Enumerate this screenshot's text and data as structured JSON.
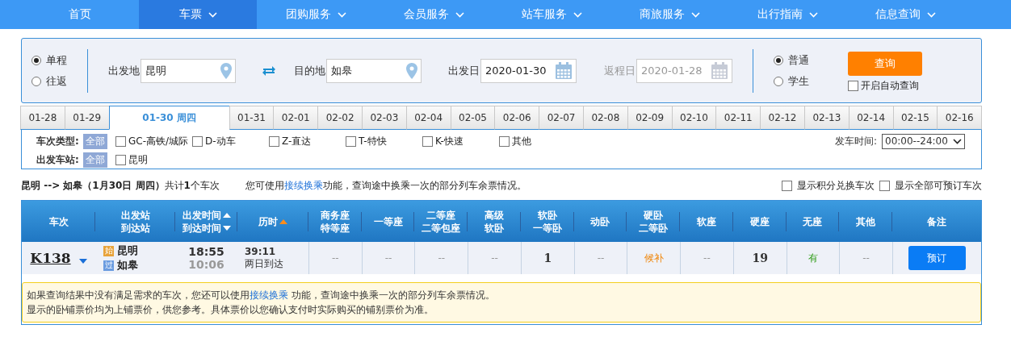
{
  "nav": [
    {
      "label": "首页",
      "dropdown": false,
      "selected": false
    },
    {
      "label": "车票",
      "dropdown": true,
      "selected": true
    },
    {
      "label": "团购服务",
      "dropdown": true,
      "selected": false
    },
    {
      "label": "会员服务",
      "dropdown": true,
      "selected": false
    },
    {
      "label": "站车服务",
      "dropdown": true,
      "selected": false
    },
    {
      "label": "商旅服务",
      "dropdown": true,
      "selected": false
    },
    {
      "label": "出行指南",
      "dropdown": true,
      "selected": false
    },
    {
      "label": "信息查询",
      "dropdown": true,
      "selected": false
    }
  ],
  "search": {
    "trip_types": [
      {
        "label": "单程",
        "selected": true
      },
      {
        "label": "往返",
        "selected": false
      }
    ],
    "from": {
      "label": "出发地",
      "value": "昆明"
    },
    "to": {
      "label": "目的地",
      "value": "如皋"
    },
    "depart_date": {
      "label": "出发日",
      "value": "2020-01-30",
      "disabled": false
    },
    "return_date": {
      "label": "返程日",
      "value": "2020-01-28",
      "disabled": true
    },
    "passenger_types": [
      {
        "label": "普通",
        "selected": true
      },
      {
        "label": "学生",
        "selected": false
      }
    ],
    "query_button": "查询",
    "auto_query": {
      "label": "开启自动查询",
      "checked": false
    }
  },
  "date_tabs": [
    {
      "label": "01-28",
      "selected": false
    },
    {
      "label": "01-29",
      "selected": false
    },
    {
      "label": "01-30 周四",
      "selected": true
    },
    {
      "label": "01-31",
      "selected": false
    },
    {
      "label": "02-01",
      "selected": false
    },
    {
      "label": "02-02",
      "selected": false
    },
    {
      "label": "02-03",
      "selected": false
    },
    {
      "label": "02-04",
      "selected": false
    },
    {
      "label": "02-05",
      "selected": false
    },
    {
      "label": "02-06",
      "selected": false
    },
    {
      "label": "02-07",
      "selected": false
    },
    {
      "label": "02-08",
      "selected": false
    },
    {
      "label": "02-09",
      "selected": false
    },
    {
      "label": "02-10",
      "selected": false
    },
    {
      "label": "02-11",
      "selected": false
    },
    {
      "label": "02-12",
      "selected": false
    },
    {
      "label": "02-13",
      "selected": false
    },
    {
      "label": "02-14",
      "selected": false
    },
    {
      "label": "02-15",
      "selected": false
    },
    {
      "label": "02-16",
      "selected": false
    }
  ],
  "filters": {
    "train_type": {
      "label": "车次类型:",
      "all": "全部",
      "options": [
        {
          "label": "GC-高铁/城际",
          "checked": false
        },
        {
          "label": "D-动车",
          "checked": false
        },
        {
          "label": "Z-直达",
          "checked": false
        },
        {
          "label": "T-特快",
          "checked": false
        },
        {
          "label": "K-快速",
          "checked": false
        },
        {
          "label": "其他",
          "checked": false
        }
      ]
    },
    "station": {
      "label": "出发车站:",
      "all": "全部",
      "options": [
        {
          "label": "昆明",
          "checked": false
        }
      ]
    },
    "depart_time": {
      "label": "发车时间:",
      "value": "00:00--24:00"
    }
  },
  "summary": {
    "text": "**昆明 --> 如皋（1月30日 周四）**共计**1**个车次",
    "note_prefix": "您可使用",
    "note_link": "接续换乘",
    "note_suffix": "功能，查询途中换乘一次的部分列车余票情况。"
  },
  "options": [
    {
      "label": "显示积分兑换车次",
      "checked": false
    },
    {
      "label": "显示全部可预订车次",
      "checked": false
    }
  ],
  "table": {
    "columns": [
      {
        "lines": [
          {
            "text": "车次"
          }
        ]
      },
      {
        "lines": [
          {
            "text": "出发站"
          },
          {
            "text": "到达站"
          }
        ]
      },
      {
        "lines": [
          {
            "text": "出发时间",
            "sort_up": true
          },
          {
            "text": "到达时间",
            "sort_down": true
          }
        ]
      },
      {
        "lines": [
          {
            "text": "历时",
            "sort_up": true
          }
        ],
        "sort_active": true
      },
      {
        "lines": [
          {
            "text": "商务座"
          },
          {
            "text": "特等座"
          }
        ]
      },
      {
        "lines": [
          {
            "text": "一等座"
          }
        ]
      },
      {
        "lines": [
          {
            "text": "二等座"
          },
          {
            "text": "二等包座"
          }
        ]
      },
      {
        "lines": [
          {
            "text": "高级"
          },
          {
            "text": "软卧"
          }
        ]
      },
      {
        "lines": [
          {
            "text": "软卧"
          },
          {
            "text": "一等卧"
          }
        ]
      },
      {
        "lines": [
          {
            "text": "动卧"
          }
        ]
      },
      {
        "lines": [
          {
            "text": "硬卧"
          },
          {
            "text": "二等卧"
          }
        ]
      },
      {
        "lines": [
          {
            "text": "软座"
          }
        ]
      },
      {
        "lines": [
          {
            "text": "硬座"
          }
        ]
      },
      {
        "lines": [
          {
            "text": "无座"
          }
        ]
      },
      {
        "lines": [
          {
            "text": "其他"
          }
        ]
      },
      {
        "lines": [
          {
            "text": "备注"
          }
        ]
      }
    ],
    "rows": [
      {
        "train": "K138",
        "expanded": false,
        "stations": [
          {
            "tag": "始",
            "name": "昆明",
            "kind": "origin"
          },
          {
            "tag": "过",
            "name": "如皋",
            "kind": "pass"
          }
        ],
        "depart": "18:55",
        "arrive": "10:06",
        "duration": "39:11",
        "arrival_day": "两日到达",
        "seats": [
          {
            "kind": "none",
            "text": "--"
          },
          {
            "kind": "none",
            "text": "--"
          },
          {
            "kind": "none",
            "text": "--"
          },
          {
            "kind": "none",
            "text": "--"
          },
          {
            "kind": "count",
            "text": "1"
          },
          {
            "kind": "none",
            "text": "--"
          },
          {
            "kind": "waitlist",
            "text": "候补"
          },
          {
            "kind": "none",
            "text": "--"
          },
          {
            "kind": "count",
            "text": "19"
          },
          {
            "kind": "available",
            "text": "有"
          },
          {
            "kind": "none",
            "text": "--"
          }
        ],
        "button": "预订"
      }
    ]
  },
  "notice": {
    "line1_prefix": "如果查询结果中没有满足需求的车次，您还可以使用",
    "line1_link": "接续换乘",
    "line1_suffix": " 功能，查询途中换乘一次的部分列车余票情况。",
    "line2": "显示的卧铺票价均为上铺票价，供您参考。具体票价以您确认支付时实际购买的铺别票价为准。"
  }
}
